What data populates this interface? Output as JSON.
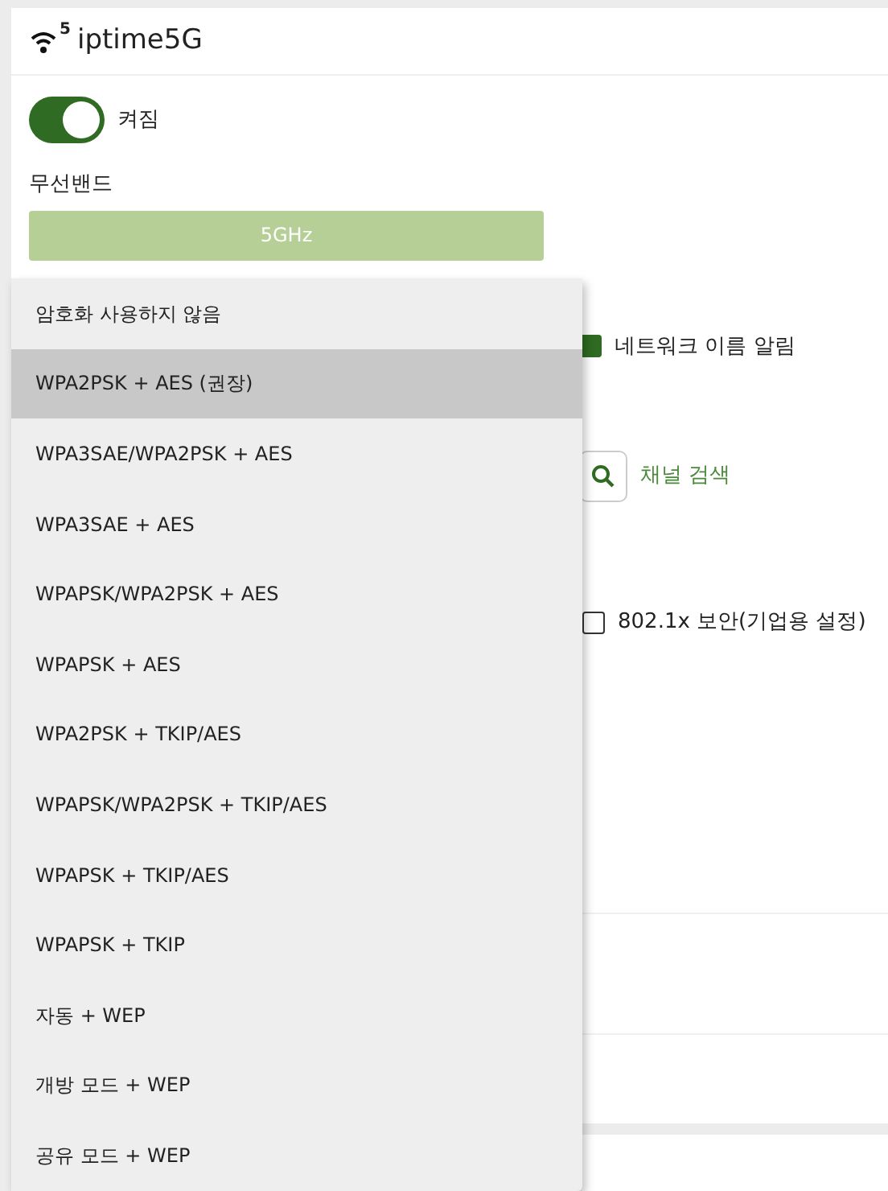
{
  "header": {
    "icon_badge": "5",
    "title": "iptime5G"
  },
  "power": {
    "on": true,
    "label": "켜짐"
  },
  "band": {
    "label": "무선밴드",
    "value": "5GHz"
  },
  "ssid_broadcast": {
    "label": "네트워크 이름 알림",
    "checked": true
  },
  "channel_search": {
    "label": "채널 검색"
  },
  "enterprise": {
    "label": "802.1x 보안(기업용 설정)",
    "checked": false
  },
  "encryption_menu": {
    "items": [
      {
        "label": "암호화 사용하지 않음",
        "selected": false
      },
      {
        "label": "WPA2PSK + AES (권장)",
        "selected": true
      },
      {
        "label": "WPA3SAE/WPA2PSK + AES",
        "selected": false
      },
      {
        "label": "WPA3SAE + AES",
        "selected": false
      },
      {
        "label": "WPAPSK/WPA2PSK + AES",
        "selected": false
      },
      {
        "label": "WPAPSK + AES",
        "selected": false
      },
      {
        "label": "WPA2PSK + TKIP/AES",
        "selected": false
      },
      {
        "label": "WPAPSK/WPA2PSK + TKIP/AES",
        "selected": false
      },
      {
        "label": "WPAPSK + TKIP/AES",
        "selected": false
      },
      {
        "label": "WPAPSK + TKIP",
        "selected": false
      },
      {
        "label": "자동 + WEP",
        "selected": false
      },
      {
        "label": "개방 모드 + WEP",
        "selected": false
      },
      {
        "label": "공유 모드 + WEP",
        "selected": false
      }
    ]
  }
}
